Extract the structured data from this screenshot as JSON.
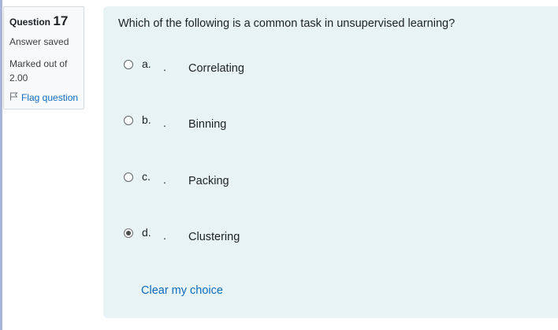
{
  "info": {
    "question_label": "Question",
    "question_number": "17",
    "status": "Answer saved",
    "marked_out_of": "Marked out of 2.00",
    "flag_label": "Flag question"
  },
  "question": {
    "text": "Which of the following is a common task in unsupervised learning?",
    "options": [
      {
        "letter": "a.",
        "dot": ".",
        "label": "Correlating",
        "selected": false
      },
      {
        "letter": "b.",
        "dot": ".",
        "label": "Binning",
        "selected": false
      },
      {
        "letter": "c.",
        "dot": ".",
        "label": "Packing",
        "selected": false
      },
      {
        "letter": "d.",
        "dot": ".",
        "label": "Clustering",
        "selected": true
      }
    ],
    "clear_label": "Clear my choice"
  },
  "colors": {
    "link": "#0f6cbf",
    "content_bg": "#e7f3f5",
    "info_bg": "#f8f9fa"
  },
  "icons": {
    "flag": "flag-icon"
  }
}
